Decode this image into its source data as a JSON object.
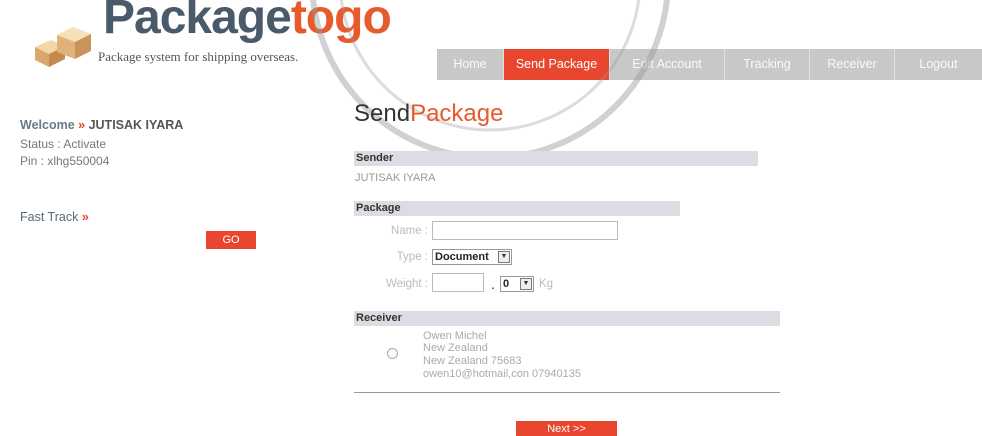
{
  "header": {
    "logo_main": "Package",
    "logo_accent": "togo",
    "tagline": "Package system for shipping overseas."
  },
  "nav": {
    "items": [
      {
        "label": "Home",
        "active": false
      },
      {
        "label": "Send Package",
        "active": true
      },
      {
        "label": "Edit Account",
        "active": false
      },
      {
        "label": "Tracking",
        "active": false
      },
      {
        "label": "Receiver",
        "active": false
      },
      {
        "label": "Logout",
        "active": false
      }
    ]
  },
  "sidebar": {
    "welcome_label": "Welcome",
    "arrow": "»",
    "user_name": "JUTISAK IYARA",
    "status": "Status : Activate",
    "pin": "Pin : xlhg550004",
    "fast_track_label": "Fast Track",
    "go_label": "GO"
  },
  "main": {
    "title_main": "Send",
    "title_accent": "Package",
    "sender": {
      "heading": "Sender",
      "name": "JUTISAK IYARA"
    },
    "package": {
      "heading": "Package",
      "name_label": "Name :",
      "name_value": "",
      "type_label": "Type :",
      "type_value": "Document",
      "weight_label": "Weight :",
      "weight_value": "",
      "weight_separator": ".",
      "weight_decimal": "0",
      "unit": "Kg"
    },
    "receiver": {
      "heading": "Receiver",
      "name": "Owen Michel",
      "country": "New Zealand",
      "address": "New Zealand 75683",
      "contact": "owen10@hotmail,con 07940135"
    },
    "next_label": "Next >>"
  },
  "colors": {
    "accent": "#e8462e",
    "nav_bg": "#c8c8c8",
    "section_bg": "#dcdce2",
    "logo_dark": "#4b5a6a"
  },
  "icons": {
    "logo": "package-boxes-icon",
    "dropdown": "chevron-down-icon"
  }
}
